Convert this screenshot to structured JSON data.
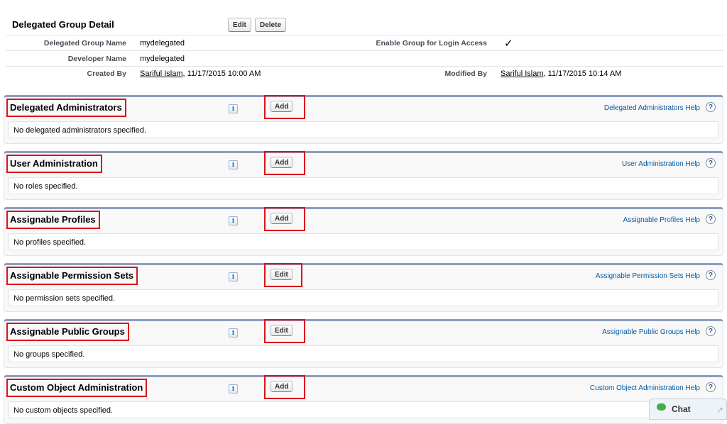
{
  "detail": {
    "title": "Delegated Group Detail",
    "edit_label": "Edit",
    "delete_label": "Delete",
    "fields": {
      "group_name_label": "Delegated Group Name",
      "group_name_value": "mydelegated",
      "login_access_label": "Enable Group for Login Access",
      "login_access_value": "✓",
      "developer_name_label": "Developer Name",
      "developer_name_value": "mydelegated",
      "created_by_label": "Created By",
      "created_by_user": "Sariful Islam",
      "created_by_date": ", 11/17/2015 10:00 AM",
      "modified_by_label": "Modified By",
      "modified_by_user": "Sariful Islam",
      "modified_by_date": ", 11/17/2015 10:14 AM"
    }
  },
  "sections": [
    {
      "title": "Delegated Administrators",
      "button": "Add",
      "help": "Delegated Administrators Help",
      "empty": "No delegated administrators specified."
    },
    {
      "title": "User Administration",
      "button": "Add",
      "help": "User Administration Help",
      "empty": "No roles specified."
    },
    {
      "title": "Assignable Profiles",
      "button": "Add",
      "help": "Assignable Profiles Help",
      "empty": "No profiles specified."
    },
    {
      "title": "Assignable Permission Sets",
      "button": "Edit",
      "help": "Assignable Permission Sets Help",
      "empty": "No permission sets specified."
    },
    {
      "title": "Assignable Public Groups",
      "button": "Edit",
      "help": "Assignable Public Groups Help",
      "empty": "No groups specified."
    },
    {
      "title": "Custom Object Administration",
      "button": "Add",
      "help": "Custom Object Administration Help",
      "empty": "No custom objects specified."
    }
  ],
  "icons": {
    "info": "i",
    "help": "?"
  },
  "chat": {
    "label": "Chat",
    "arrow": "↗"
  }
}
